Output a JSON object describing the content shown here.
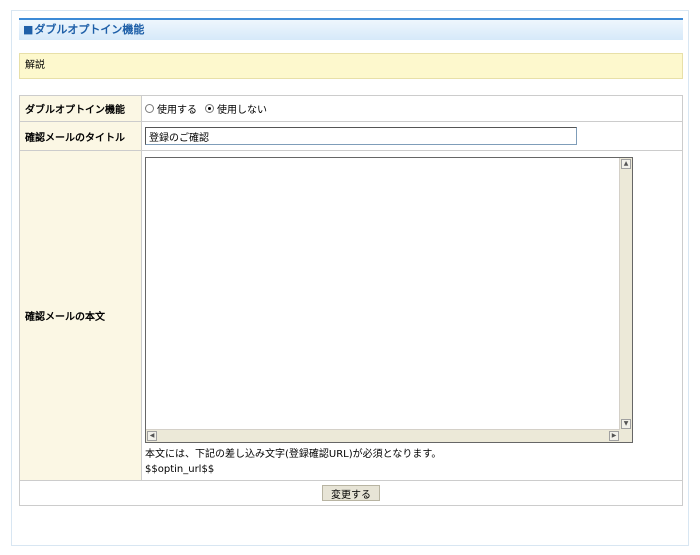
{
  "header": {
    "title_square": "■",
    "title": "ダブルオプトイン機能"
  },
  "description": {
    "label": "解説"
  },
  "form": {
    "double_optin": {
      "label": "ダブルオプトイン機能",
      "options": [
        "使用する",
        "使用しない"
      ],
      "selected": "使用しない"
    },
    "confirm_title": {
      "label": "確認メールのタイトル",
      "value": "登録のご確認"
    },
    "confirm_body": {
      "label": "確認メールの本文",
      "value": "",
      "note": "本文には、下記の差し込み文字(登録確認URL)が必須となります。",
      "placeholder_token": "$$optin_url$$"
    },
    "submit_label": "変更する"
  }
}
